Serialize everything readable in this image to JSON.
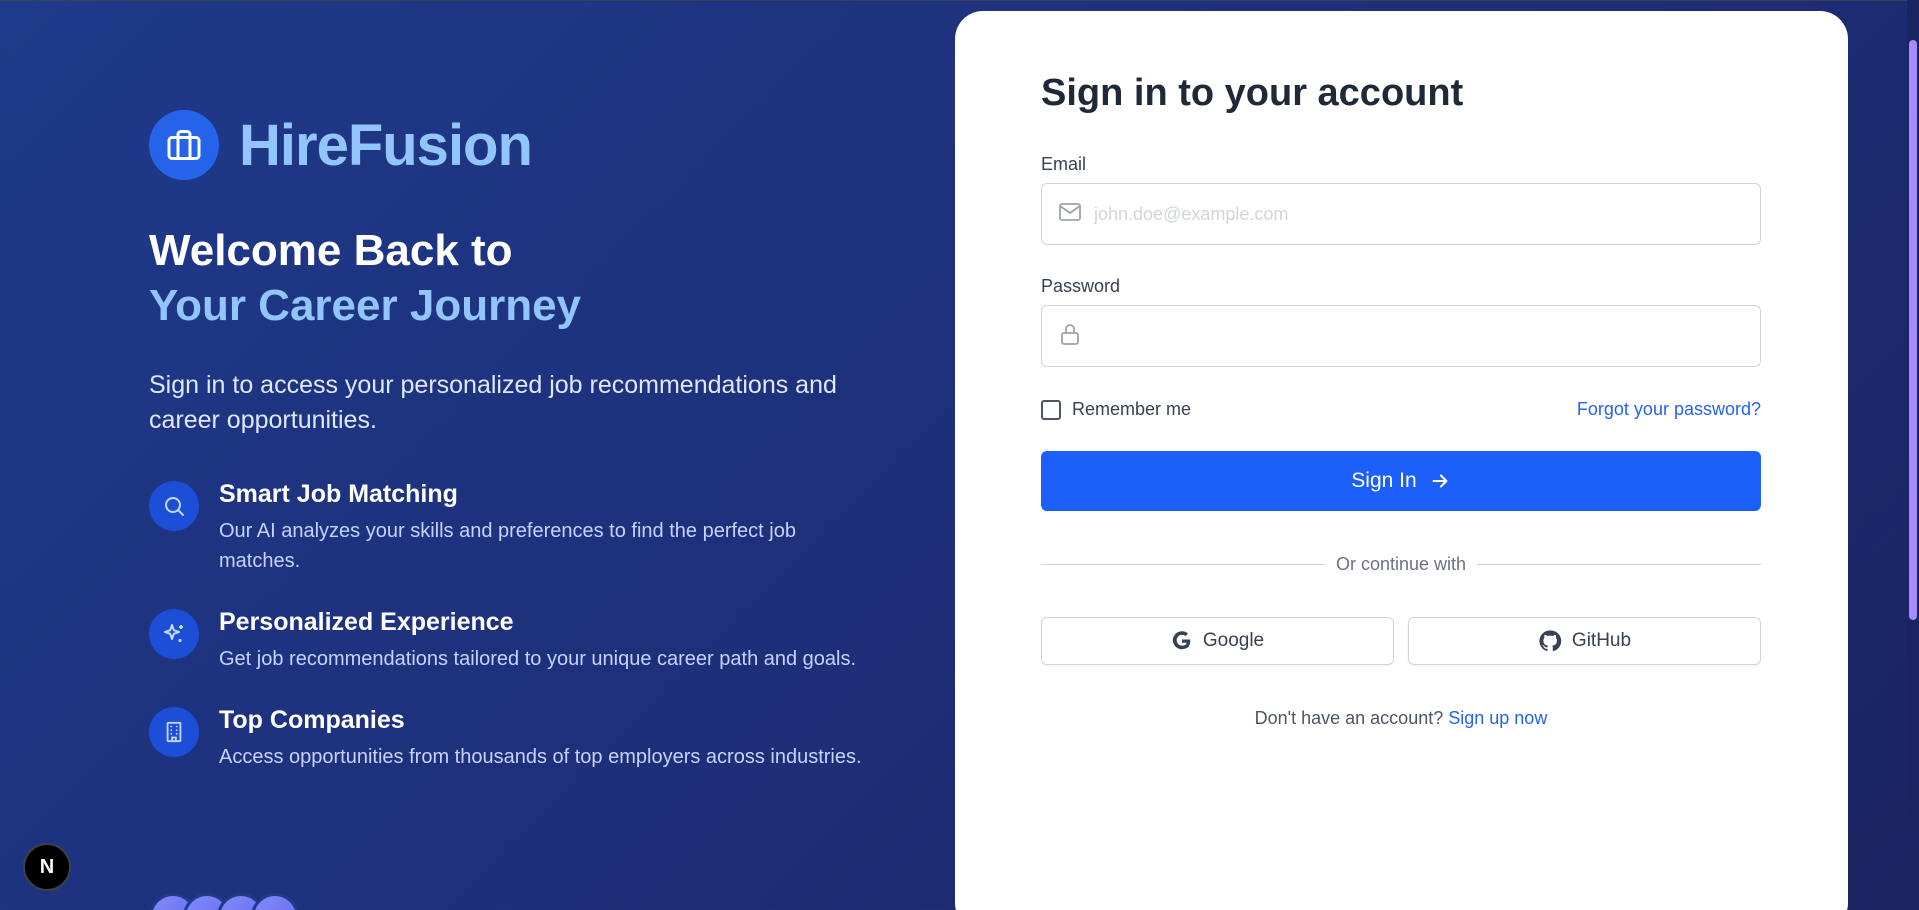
{
  "brand": {
    "name": "HireFusion",
    "icon": "briefcase-icon"
  },
  "hero": {
    "line1": "Welcome Back to",
    "line2": "Your Career Journey",
    "intro": "Sign in to access your personalized job recommendations and career opportunities."
  },
  "features": [
    {
      "icon": "search-icon",
      "title": "Smart Job Matching",
      "desc": "Our AI analyzes your skills and preferences to find the perfect job matches."
    },
    {
      "icon": "sparkles-icon",
      "title": "Personalized Experience",
      "desc": "Get job recommendations tailored to your unique career path and goals."
    },
    {
      "icon": "building-icon",
      "title": "Top Companies",
      "desc": "Access opportunities from thousands of top employers across industries."
    }
  ],
  "form": {
    "title": "Sign in to your account",
    "email_label": "Email",
    "email_placeholder": "john.doe@example.com",
    "email_value": "",
    "password_label": "Password",
    "password_value": "",
    "remember_label": "Remember me",
    "remember_checked": false,
    "forgot_label": "Forgot your password?",
    "submit_label": "Sign In",
    "divider_label": "Or continue with",
    "google_label": "Google",
    "github_label": "GitHub",
    "signup_prompt": "Don't have an account?",
    "signup_link": "Sign up now"
  },
  "next_badge": "N",
  "colors": {
    "accent": "#1d5ffb",
    "brand_light": "#93c5fd",
    "bg_dark": "#1e3a8a",
    "link": "#2563eb"
  }
}
